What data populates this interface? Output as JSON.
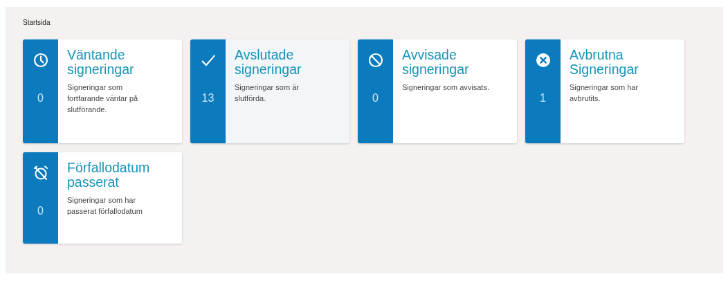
{
  "breadcrumb": "Startsida",
  "cards": [
    {
      "kind": "clock",
      "count": "0",
      "title": "Väntande signeringar",
      "description": "Signeringar som fortfarande väntar på slutförande.",
      "hovered": false
    },
    {
      "kind": "check",
      "count": "13",
      "title": "Avslutade signeringar",
      "description": "Signeringar som är slutförda.",
      "hovered": true
    },
    {
      "kind": "ban",
      "count": "0",
      "title": "Avvisade signeringar",
      "description": "Signeringar som avvisats.",
      "hovered": false
    },
    {
      "kind": "cancel",
      "count": "1",
      "title": "Avbrutna Signeringar",
      "description": "Signeringar som har avbrutits.",
      "hovered": false
    },
    {
      "kind": "expired",
      "count": "0",
      "title": "Förfallodatum passerat",
      "description": "Signeringar som har passerat förfallodatum",
      "hovered": false
    }
  ]
}
